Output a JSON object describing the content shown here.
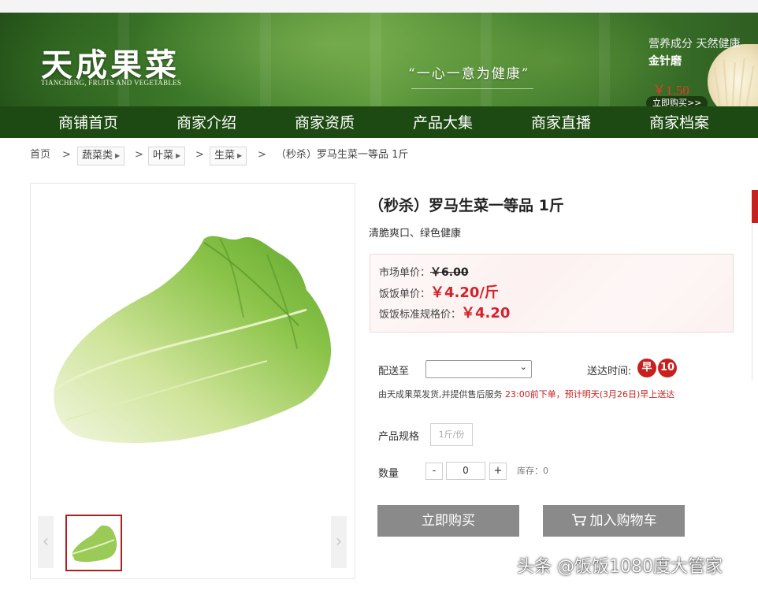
{
  "banner": {
    "logo_cn": "天成果菜",
    "logo_en": "TIANCHENG, FRUITS AND VEGETABLES",
    "slogan": "“一心一意为健康”",
    "promo": {
      "subtitle": "营养成分 天然健康",
      "name": "金针磨",
      "price": "￥1.50",
      "buy": "立即购买>>"
    }
  },
  "nav": [
    "商铺首页",
    "商家介绍",
    "商家资质",
    "产品大集",
    "商家直播",
    "商家档案"
  ],
  "breadcrumb": {
    "home": "首页",
    "sep": ">",
    "levels": [
      "蔬菜类",
      "叶菜",
      "生菜"
    ],
    "current": "（秒杀）罗马生菜一等品 1斤"
  },
  "product": {
    "title": "（秒杀）罗马生菜一等品 1斤",
    "subtitle": "清脆爽口、绿色健康",
    "prices": {
      "market_label": "市场单价：",
      "market_value": "￥6.00",
      "fanfan_label": "饭饭单价：",
      "fanfan_value": "￥4.20/斤",
      "standard_label": "饭饭标准规格价：",
      "standard_value": "￥4.20"
    },
    "delivery": {
      "label": "配送至",
      "select_value": "",
      "time_label": "送达时间:",
      "badges": [
        "早",
        "10"
      ],
      "notice_prefix": "由天成果菜发货,并提供售后服务 ",
      "notice_highlight": "23:00前下单，预计明天(3月26日)早上送达"
    },
    "spec": {
      "label": "产品规格",
      "value": "1斤/份"
    },
    "quantity": {
      "label": "数量",
      "minus": "-",
      "value": "0",
      "plus": "+",
      "stock": "库存：0"
    },
    "buttons": {
      "buy_now": "立即购买",
      "add_cart": "加入购物车"
    }
  },
  "gallery": {
    "prev": "‹",
    "next": "›"
  },
  "watermark": "头条 @饭饭1080度大管家",
  "colors": {
    "nav_bg": "#1d4a12",
    "accent_red": "#d6202a",
    "button_gray": "#8a8a8a"
  }
}
